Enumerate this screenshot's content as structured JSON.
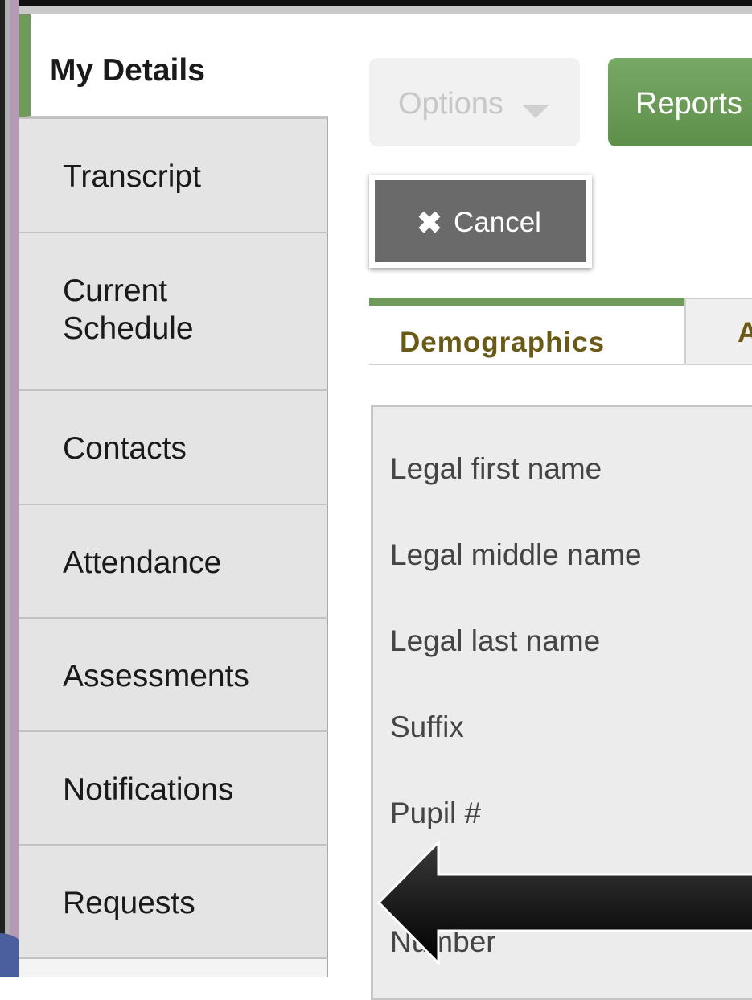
{
  "sidebar": {
    "active": "My Details",
    "items": [
      {
        "label": "Transcript"
      },
      {
        "label": "Current Schedule"
      },
      {
        "label": "Contacts"
      },
      {
        "label": "Attendance"
      },
      {
        "label": "Assessments"
      },
      {
        "label": "Notifications"
      },
      {
        "label": "Requests"
      }
    ]
  },
  "toolbar": {
    "options_label": "Options",
    "reports_label": "Reports",
    "cancel_label": "Cancel"
  },
  "tabs": {
    "active": "Demographics",
    "next_partial": "A"
  },
  "form": {
    "fields": [
      "Legal first name",
      "Legal middle name",
      "Legal last name",
      "Suffix",
      "Pupil #",
      "Number"
    ]
  },
  "colors": {
    "accent_green": "#6f9a5b",
    "tab_text": "#6b5a16",
    "cancel_bg": "#6a6a6a"
  },
  "icons": {
    "cancel": "close-icon",
    "options": "caret-down-icon",
    "annotation": "left-arrow-icon"
  }
}
